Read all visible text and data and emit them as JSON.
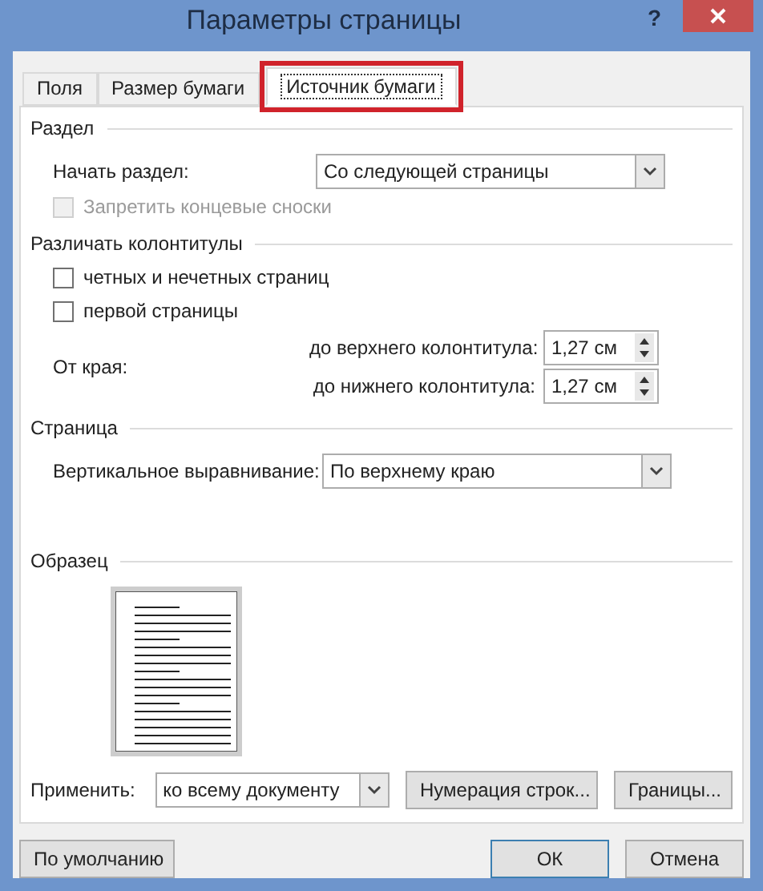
{
  "window": {
    "title": "Параметры страницы",
    "help": "?"
  },
  "tabs": [
    {
      "label": "Поля",
      "selected": false,
      "highlighted": false
    },
    {
      "label": "Размер бумаги",
      "selected": false,
      "highlighted": false
    },
    {
      "label": "Источник бумаги",
      "selected": true,
      "highlighted": true
    }
  ],
  "section": {
    "heading": "Раздел",
    "start_label": "Начать раздел:",
    "start_value": "Со следующей страницы",
    "suppress": {
      "label": "Запретить концевые сноски",
      "checked": false,
      "disabled": true
    }
  },
  "headers_footers": {
    "heading": "Различать колонтитулы",
    "checkboxes": [
      {
        "label": "четных и нечетных страниц",
        "checked": false
      },
      {
        "label": "первой страницы",
        "checked": false
      }
    ],
    "from_edge_label": "От края:",
    "spinners": [
      {
        "label": "до верхнего колонтитула:",
        "value": "1,27 см"
      },
      {
        "label": "до нижнего колонтитула:",
        "value": "1,27 см"
      }
    ]
  },
  "page": {
    "heading": "Страница",
    "align_label": "Вертикальное выравнивание:",
    "align_value": "По верхнему краю"
  },
  "preview": {
    "heading": "Образец"
  },
  "apply": {
    "label": "Применить:",
    "value": "ко всему документу"
  },
  "buttons": [
    "Нумерация строк...",
    "Границы..."
  ],
  "footer": {
    "default_button": "По умолчанию",
    "buttons": [
      {
        "label": "ОК",
        "default": true
      },
      {
        "label": "Отмена",
        "default": false
      }
    ]
  }
}
